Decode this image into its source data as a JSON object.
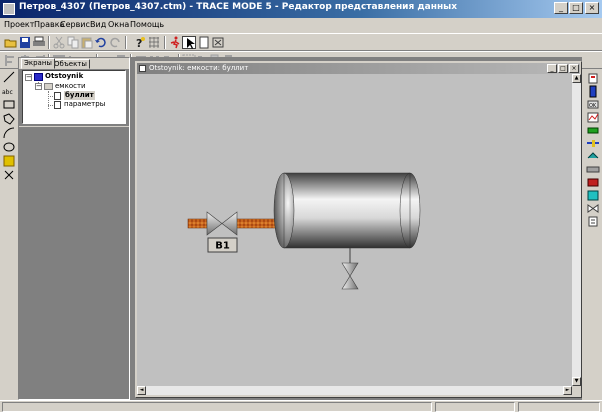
{
  "window": {
    "title": "Петров_4307 (Петров_4307.ctm) - TRACE MODE 5 - Редактор представления данных",
    "minimize_glyph": "_",
    "maximize_glyph": "□",
    "close_glyph": "×"
  },
  "menu": [
    "Проект",
    "Правка",
    "Сервис",
    "Вид",
    "Окна",
    "Помощь"
  ],
  "tree": {
    "tabs": [
      "Экраны",
      "Объекты"
    ],
    "root": "Otstoynik",
    "group": "емкости",
    "items": [
      "буллит",
      "параметры"
    ]
  },
  "child_window": {
    "title": "Otstoynik: емкости: буллит",
    "minimize_glyph": "_",
    "maximize_glyph": "□",
    "close_glyph": "×"
  },
  "canvas": {
    "valve_label": "В1",
    "pipe_color": "#c8641e",
    "background_color": "#c0c0c0"
  },
  "scrollbar": {
    "up_glyph": "▲",
    "down_glyph": "▼",
    "left_glyph": "◄",
    "right_glyph": "►"
  },
  "icons": {
    "toolbar_1": [
      "open-icon",
      "save-icon",
      "print-icon",
      "cut-icon",
      "copy-icon",
      "paste-icon",
      "undo-icon",
      "redo-icon",
      "help-icon",
      "run-icon",
      "pointer-icon",
      "page-icon",
      "fit-icon"
    ],
    "toolbar_2": [
      "align-left-icon",
      "align-center-icon",
      "align-right-icon",
      "align-top-icon",
      "align-middle-icon",
      "align-bottom-icon",
      "space-h-icon",
      "space-v-icon",
      "same-width-icon",
      "same-height-icon",
      "same-size-icon",
      "group-icon",
      "ungroup-icon",
      "bring-front-icon",
      "send-back-icon",
      "grid-icon"
    ],
    "left_tools": [
      "line-icon",
      "text-icon",
      "rectangle-icon",
      "polygon-icon",
      "arc-icon",
      "ellipse-icon",
      "image-icon",
      "cross-icon"
    ],
    "right_tools": [
      "indicator-icon",
      "tank-icon",
      "button-icon",
      "trend-icon",
      "bar-icon",
      "slider-icon",
      "switch-icon",
      "pipe-icon",
      "motor-icon",
      "display-icon",
      "valve-icon",
      "gauge-icon",
      "chart-icon"
    ]
  }
}
